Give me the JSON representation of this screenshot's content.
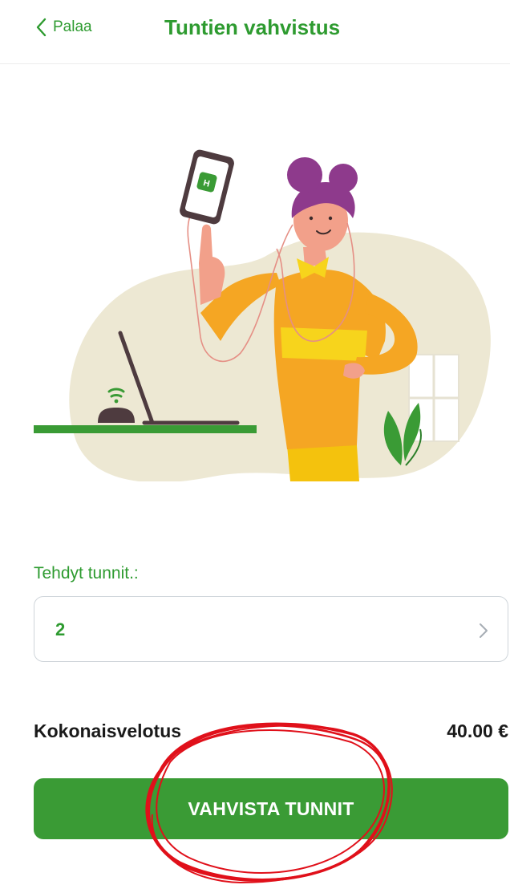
{
  "header": {
    "back_label": "Palaa",
    "title": "Tuntien vahvistus"
  },
  "illustration": {
    "phone_badge": "H"
  },
  "hours_field": {
    "label": "Tehdyt tunnit.:",
    "value": "2"
  },
  "summary": {
    "total_label": "Kokonaisvelotus",
    "total_value": "40.00 €"
  },
  "confirm_button": {
    "label": "VAHVISTA TUNNIT"
  },
  "colors": {
    "brand_green": "#2e9b30",
    "button_green": "#3a9b35",
    "annotation_red": "#e0101a"
  },
  "icons": {
    "back": "chevron-left-icon",
    "select": "chevron-right-icon"
  }
}
